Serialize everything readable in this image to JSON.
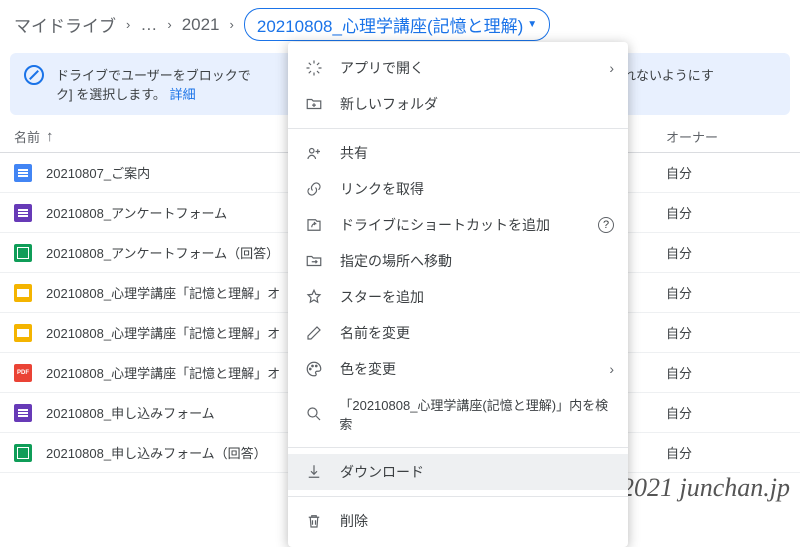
{
  "breadcrumb": {
    "root": "マイドライブ",
    "mid": "…",
    "year": "2021",
    "active": "20210808_心理学講座(記憶と理解)"
  },
  "notice": {
    "text1": "ドライブでユーザーをブロックで",
    "text2": "ルを共有されないようにす",
    "text3": "ク] を選択します。",
    "link": "詳細"
  },
  "headers": {
    "name": "名前",
    "owner": "オーナー"
  },
  "owner_self": "自分",
  "files": [
    {
      "icon": "docs",
      "name": "20210807_ご案内"
    },
    {
      "icon": "forms",
      "name": "20210808_アンケートフォーム"
    },
    {
      "icon": "sheets",
      "name": "20210808_アンケートフォーム（回答）"
    },
    {
      "icon": "slides",
      "name": "20210808_心理学講座「記憶と理解」オ"
    },
    {
      "icon": "slides",
      "name": "20210808_心理学講座「記憶と理解」オ"
    },
    {
      "icon": "pdf",
      "name": "20210808_心理学講座「記憶と理解」オ"
    },
    {
      "icon": "forms",
      "name": "20210808_申し込みフォーム"
    },
    {
      "icon": "sheets",
      "name": "20210808_申し込みフォーム（回答）"
    }
  ],
  "menu": {
    "open_with": "アプリで開く",
    "new_folder": "新しいフォルダ",
    "share": "共有",
    "get_link": "リンクを取得",
    "add_shortcut": "ドライブにショートカットを追加",
    "move_to": "指定の場所へ移動",
    "add_star": "スターを追加",
    "rename": "名前を変更",
    "change_color": "色を変更",
    "search_in": "「20210808_心理学講座(記憶と理解)」内を検索",
    "download": "ダウンロード",
    "delete": "削除"
  },
  "watermark": "©2021 junchan.jp"
}
